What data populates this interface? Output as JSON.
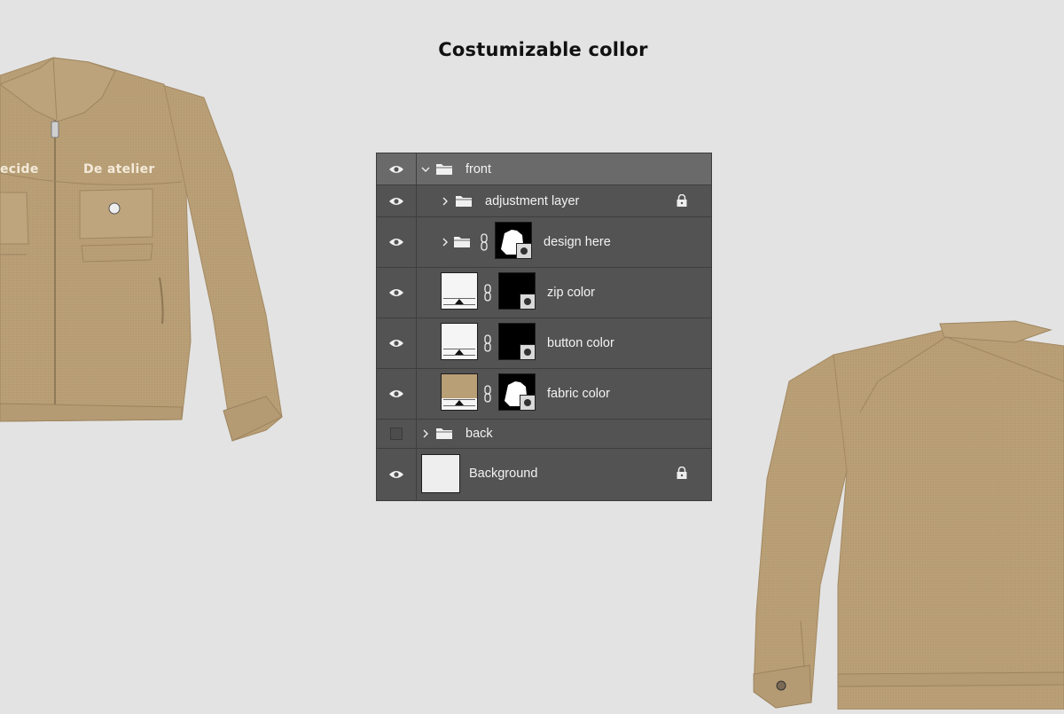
{
  "headline": "Costumizable collor",
  "jacket_front": {
    "chest_left": "ecide",
    "chest_right": "De atelier"
  },
  "colors": {
    "fabric": "#b99f76",
    "panel": "#535353",
    "selected_row": "#6a6a6a",
    "background": "#e3e3e3"
  },
  "layers": {
    "front": {
      "name": "front",
      "icon": "folder-icon"
    },
    "adjustment": {
      "name": "adjustment layer",
      "icon": "lock-icon"
    },
    "design": {
      "name": "design here"
    },
    "zip": {
      "name": "zip color"
    },
    "button": {
      "name": "button color"
    },
    "fabric": {
      "name": "fabric color"
    },
    "back": {
      "name": "back"
    },
    "background": {
      "name": "Background"
    }
  }
}
